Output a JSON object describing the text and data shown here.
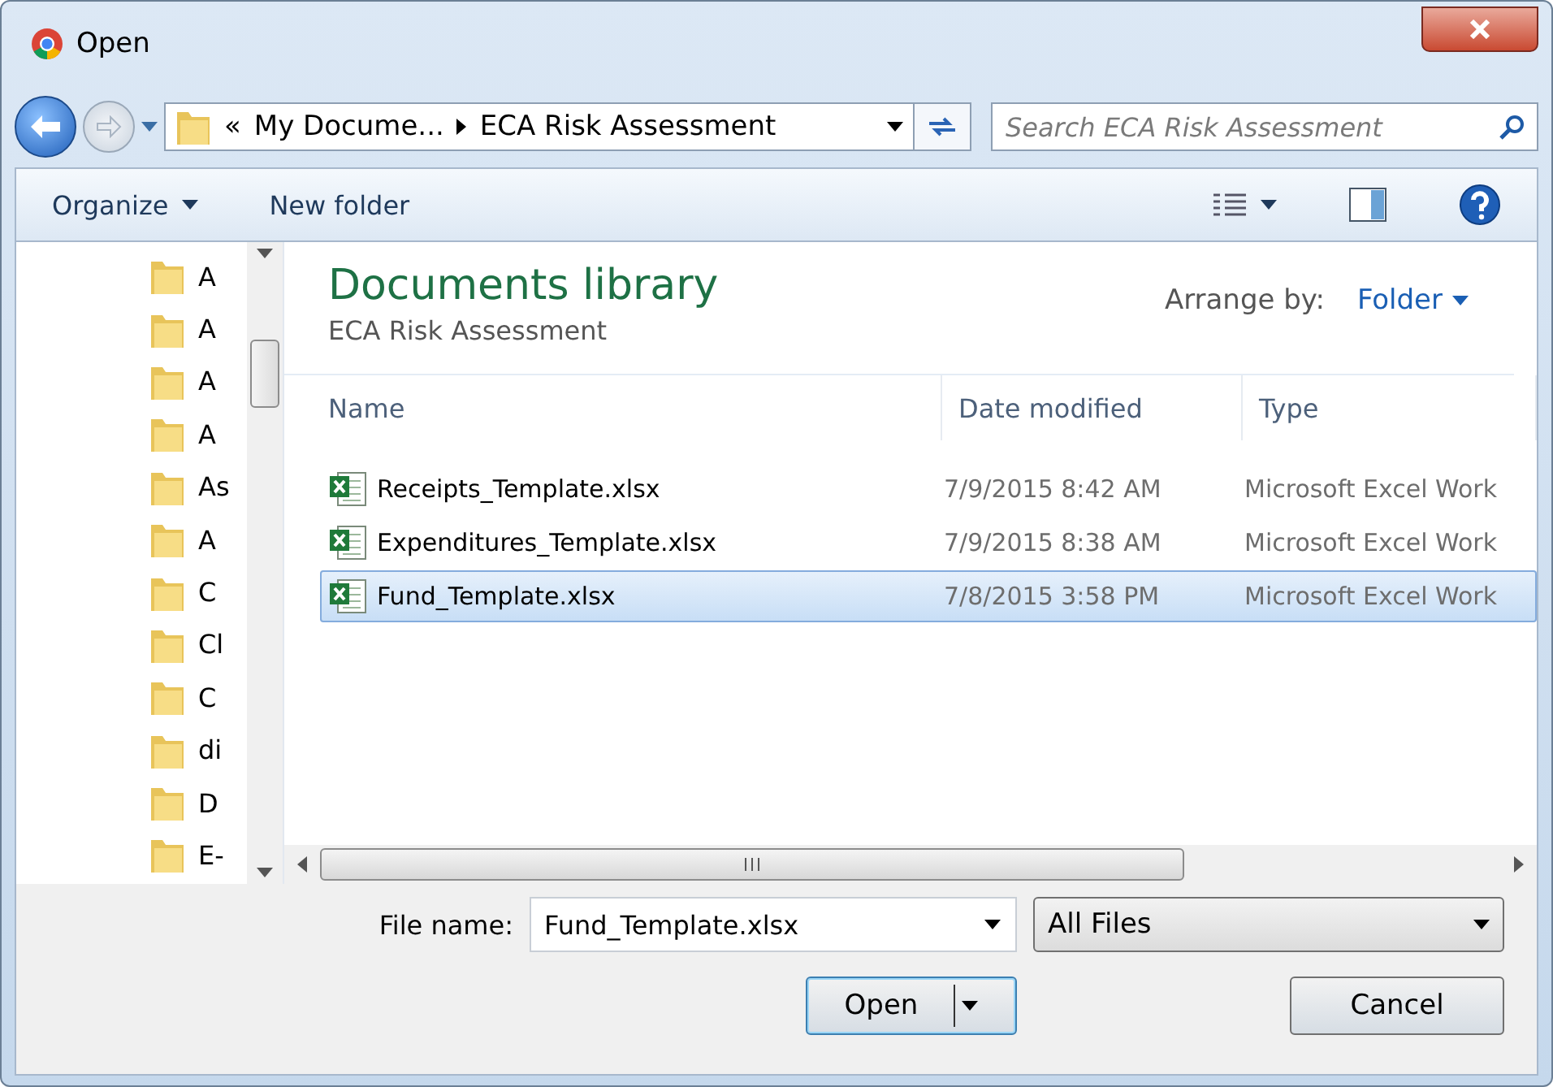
{
  "window": {
    "title": "Open"
  },
  "address": {
    "overflow": "«",
    "segments": [
      "My Docume...",
      "ECA Risk Assessment"
    ]
  },
  "search": {
    "placeholder": "Search ECA Risk Assessment"
  },
  "toolbar": {
    "organize": "Organize",
    "new_folder": "New folder"
  },
  "sidebar": {
    "items": [
      {
        "label": "A"
      },
      {
        "label": "A"
      },
      {
        "label": "A"
      },
      {
        "label": "A"
      },
      {
        "label": "As"
      },
      {
        "label": "A"
      },
      {
        "label": "C"
      },
      {
        "label": "Cl"
      },
      {
        "label": "C"
      },
      {
        "label": "di"
      },
      {
        "label": "D"
      },
      {
        "label": "E-"
      }
    ]
  },
  "library": {
    "title": "Documents library",
    "subtitle": "ECA Risk Assessment",
    "arrange_label": "Arrange by:",
    "arrange_value": "Folder"
  },
  "table": {
    "columns": [
      "Name",
      "Date modified",
      "Type"
    ],
    "rows": [
      {
        "name": "Receipts_Template.xlsx",
        "date": "7/9/2015 8:42 AM",
        "type": "Microsoft Excel Work",
        "selected": false
      },
      {
        "name": "Expenditures_Template.xlsx",
        "date": "7/9/2015 8:38 AM",
        "type": "Microsoft Excel Work",
        "selected": false
      },
      {
        "name": "Fund_Template.xlsx",
        "date": "7/8/2015 3:58 PM",
        "type": "Microsoft Excel Work",
        "selected": true
      }
    ]
  },
  "file_name": {
    "label": "File name:",
    "value": "Fund_Template.xlsx"
  },
  "file_type": {
    "value": "All Files"
  },
  "buttons": {
    "open": "Open",
    "cancel": "Cancel"
  }
}
